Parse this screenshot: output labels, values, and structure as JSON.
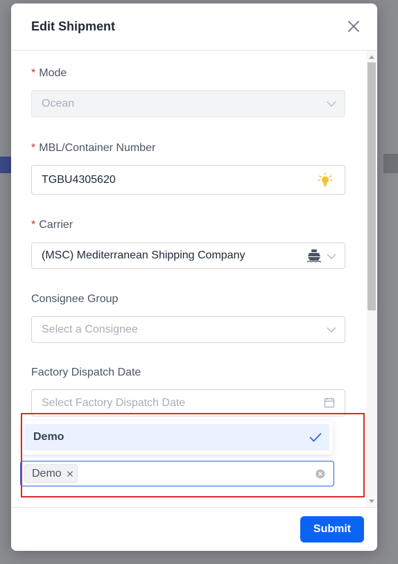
{
  "modal": {
    "title": "Edit Shipment",
    "close_icon": "close-icon"
  },
  "form": {
    "mode": {
      "label": "Mode",
      "value": "Ocean",
      "disabled": true
    },
    "mbl": {
      "label": "MBL/Container Number",
      "value": "TGBU4305620",
      "icon": "lightbulb-icon"
    },
    "carrier": {
      "label": "Carrier",
      "value": "(MSC) Mediterranean Shipping Company",
      "icon": "ship-icon"
    },
    "consignee": {
      "label": "Consignee Group",
      "placeholder": "Select a Consignee"
    },
    "dispatch": {
      "label": "Factory Dispatch Date",
      "placeholder": "Select Factory Dispatch Date",
      "icon": "calendar-icon"
    },
    "tags": {
      "options": [
        {
          "label": "Demo",
          "selected": true
        }
      ],
      "selected": [
        "Demo"
      ]
    }
  },
  "footer": {
    "submit_label": "Submit"
  },
  "colors": {
    "primary": "#0b63f6",
    "required": "#dc2626",
    "highlight": "#d62b2b",
    "selected_bg": "#eaf2ff"
  }
}
